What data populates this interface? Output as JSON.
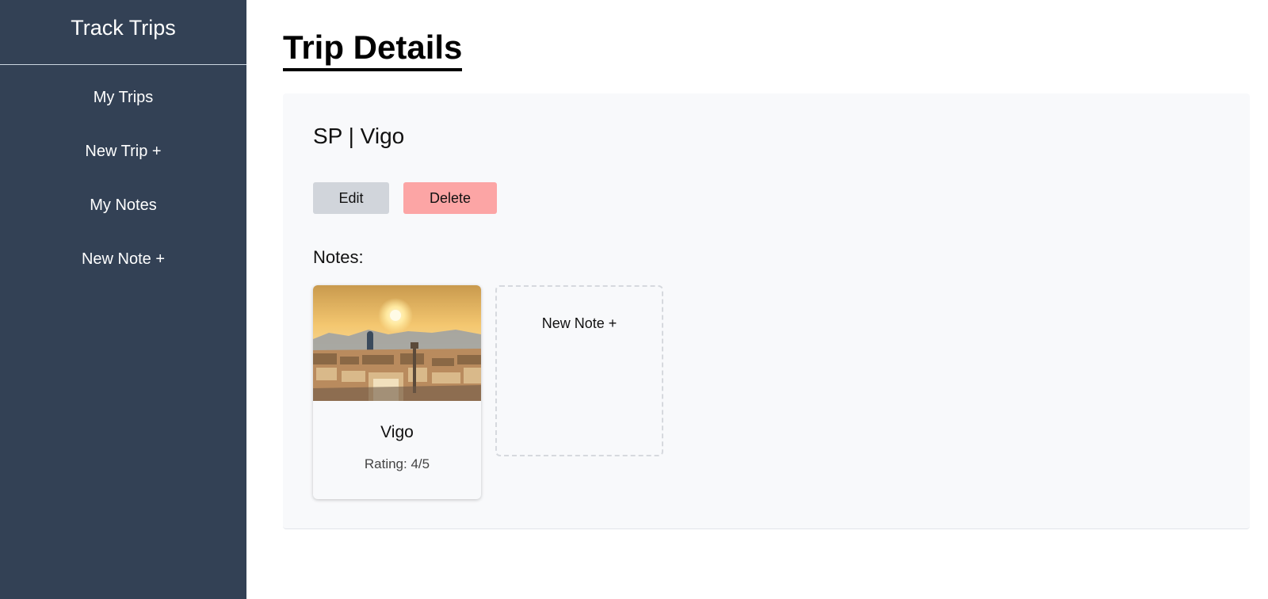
{
  "sidebar": {
    "brand": "Track Trips",
    "items": [
      {
        "label": "My Trips"
      },
      {
        "label": "New Trip +"
      },
      {
        "label": "My Notes"
      },
      {
        "label": "New Note +"
      }
    ]
  },
  "page": {
    "title": "Trip Details"
  },
  "trip": {
    "name": "SP | Vigo",
    "edit_label": "Edit",
    "delete_label": "Delete",
    "notes_label": "Notes:"
  },
  "notes": [
    {
      "title": "Vigo",
      "rating": "Rating: 4/5",
      "image": "city-skyline-sunset"
    }
  ],
  "new_note_tile": {
    "label": "New Note +"
  },
  "colors": {
    "sidebar_bg": "#334155",
    "edit_button": "#d1d5db",
    "delete_button": "#fca5a5",
    "card_bg": "#f8f9fb"
  }
}
